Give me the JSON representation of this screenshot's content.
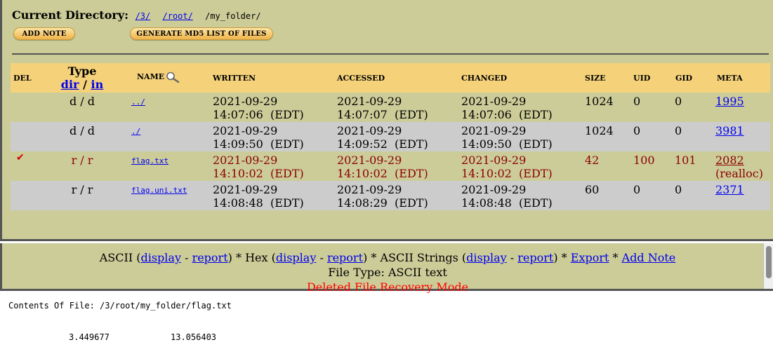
{
  "header": {
    "label": "Current Directory:",
    "path_parts": [
      "/3/",
      "/root/"
    ],
    "path_last": "/my_folder/",
    "add_note_label": "Add Note",
    "md5_label": "Generate MD5 List of Files"
  },
  "table": {
    "columns": {
      "del": "Del",
      "type": "Type",
      "type_dir": "dir",
      "type_sep": "/",
      "type_in": "in",
      "name": "Name",
      "written": "Written",
      "accessed": "Accessed",
      "changed": "Changed",
      "size": "Size",
      "uid": "UID",
      "gid": "GID",
      "meta": "Meta"
    },
    "rows": [
      {
        "deleted": "",
        "type": "d / d",
        "name": "../",
        "written_date": "2021-09-29",
        "written_time": "14:07:06  (EDT)",
        "accessed_date": "2021-09-29",
        "accessed_time": "14:07:07  (EDT)",
        "changed_date": "2021-09-29",
        "changed_time": "14:07:06  (EDT)",
        "size": "1024",
        "uid": "0",
        "gid": "0",
        "meta": "1995",
        "meta_note": ""
      },
      {
        "deleted": "",
        "type": "d / d",
        "name": "./",
        "written_date": "2021-09-29",
        "written_time": "14:09:50  (EDT)",
        "accessed_date": "2021-09-29",
        "accessed_time": "14:09:52  (EDT)",
        "changed_date": "2021-09-29",
        "changed_time": "14:09:50  (EDT)",
        "size": "1024",
        "uid": "0",
        "gid": "0",
        "meta": "3981",
        "meta_note": ""
      },
      {
        "deleted": "✔",
        "type": "r / r",
        "name": "flag.txt",
        "written_date": "2021-09-29",
        "written_time": "14:10:02  (EDT)",
        "accessed_date": "2021-09-29",
        "accessed_time": "14:10:02  (EDT)",
        "changed_date": "2021-09-29",
        "changed_time": "14:10:02  (EDT)",
        "size": "42",
        "uid": "100",
        "gid": "101",
        "meta": "2082",
        "meta_note": "(realloc)"
      },
      {
        "deleted": "",
        "type": "r / r",
        "name": "flag.uni.txt",
        "written_date": "2021-09-29",
        "written_time": "14:08:48  (EDT)",
        "accessed_date": "2021-09-29",
        "accessed_time": "14:08:29  (EDT)",
        "changed_date": "2021-09-29",
        "changed_time": "14:08:48  (EDT)",
        "size": "60",
        "uid": "0",
        "gid": "0",
        "meta": "2371",
        "meta_note": ""
      }
    ]
  },
  "viewer": {
    "ascii": "ASCII",
    "hex": "Hex",
    "ascii_strings": "ASCII Strings",
    "display": "display",
    "report": "report",
    "export": "Export",
    "add_note": "Add Note",
    "file_type": "File Type: ASCII text",
    "recovery_mode": "Deleted File Recovery Mode"
  },
  "contents": {
    "title": "Contents Of File: /3/root/my_folder/flag.txt",
    "values": [
      "3.449677",
      "13.056403"
    ]
  },
  "colors": {
    "frame_bg": "#cccc99",
    "header_bg": "#f5d27a",
    "alt_row_bg": "#cccccc",
    "deleted_text": "#8b0000",
    "link": "#0000ee",
    "recovery": "#ff0000"
  }
}
